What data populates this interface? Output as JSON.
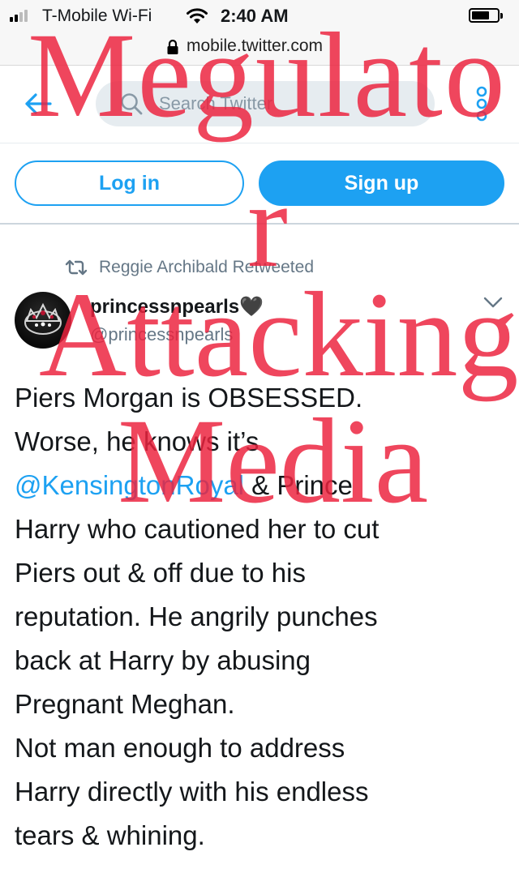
{
  "status_bar": {
    "carrier": "T-Mobile Wi-Fi",
    "time": "2:40 AM"
  },
  "browser": {
    "url": "mobile.twitter.com"
  },
  "nav": {
    "search_placeholder": "Search Twitter"
  },
  "auth": {
    "login_label": "Log in",
    "signup_label": "Sign up"
  },
  "tweet": {
    "retweet_context": "Reggie Archibald Retweeted",
    "display_name": "princessnpearls🖤",
    "handle": "@princessnpearls",
    "lines": {
      "l1": "Piers Morgan is OBSESSED.",
      "l2": "Worse, he knows it’s",
      "l3_mention": "@KensingtonRoyal",
      "l3_rest": " & Prince",
      "l4": "Harry who cautioned her to cut",
      "l5": "Piers out & off due to his",
      "l6": "reputation. He angrily punches",
      "l7": "back at Harry by abusing",
      "l8": "Pregnant Meghan.",
      "l9": "Not man enough to address",
      "l10": "Harry directly with his endless",
      "l11": "tears & whining."
    }
  },
  "overlay": {
    "line1": "Megulato",
    "line2": "r",
    "line3": "Attacking",
    "line4": "Media"
  },
  "colors": {
    "twitter_blue": "#1da1f2",
    "overlay_red": "#ec223e",
    "secondary_text": "#657786"
  }
}
